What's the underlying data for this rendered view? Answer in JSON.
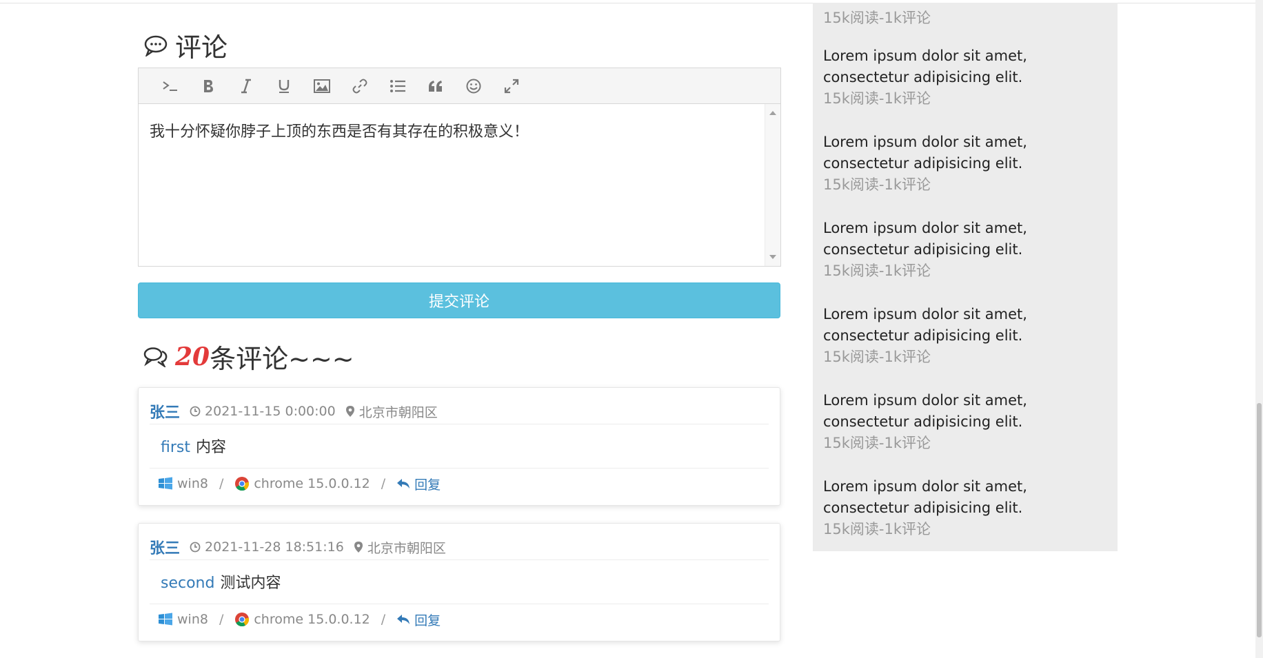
{
  "comment_form": {
    "title": "评论",
    "editor_text": "我十分怀疑你脖子上顶的东西是否有其存在的积极意义！",
    "submit_label": "提交评论",
    "toolbar_icons": [
      "terminal-icon",
      "bold-icon",
      "italic-icon",
      "underline-icon",
      "image-icon",
      "link-icon",
      "list-icon",
      "quote-icon",
      "smile-icon",
      "fullscreen-icon"
    ]
  },
  "comments_heading": {
    "count": "20",
    "suffix": "条评论~~~"
  },
  "comments": [
    {
      "author": "张三",
      "time": "2021-11-15 0:00:00",
      "location": "北京市朝阳区",
      "highlight": "first",
      "text": "内容",
      "os": "win8",
      "browser": "chrome 15.0.0.12",
      "reply": "回复"
    },
    {
      "author": "张三",
      "time": "2021-11-28 18:51:16",
      "location": "北京市朝阳区",
      "highlight": "second",
      "text": "测试内容",
      "os": "win8",
      "browser": "chrome 15.0.0.12",
      "reply": "回复"
    }
  ],
  "sidebar": {
    "top_meta": "15k阅读-1k评论",
    "items": [
      {
        "title": "Lorem ipsum dolor sit amet, consectetur adipisicing elit.",
        "meta": "15k阅读-1k评论"
      },
      {
        "title": "Lorem ipsum dolor sit amet, consectetur adipisicing elit.",
        "meta": "15k阅读-1k评论"
      },
      {
        "title": "Lorem ipsum dolor sit amet, consectetur adipisicing elit.",
        "meta": "15k阅读-1k评论"
      },
      {
        "title": "Lorem ipsum dolor sit amet, consectetur adipisicing elit.",
        "meta": "15k阅读-1k评论"
      },
      {
        "title": "Lorem ipsum dolor sit amet, consectetur adipisicing elit.",
        "meta": "15k阅读-1k评论"
      },
      {
        "title": "Lorem ipsum dolor sit amet, consectetur adipisicing elit.",
        "meta": "15k阅读-1k评论"
      }
    ]
  },
  "colors": {
    "accent": "#5bc0de",
    "link": "#337ab7",
    "count": "#e33a3a",
    "sidebar_bg": "#ececec"
  }
}
